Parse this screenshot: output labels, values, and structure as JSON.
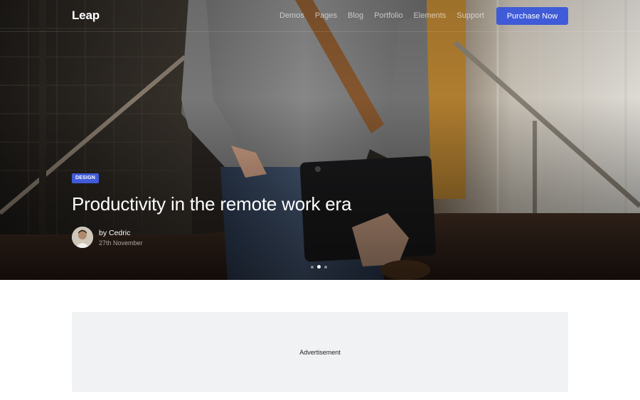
{
  "brand": {
    "name": "Leap"
  },
  "nav": {
    "links": [
      {
        "label": "Demos"
      },
      {
        "label": "Pages"
      },
      {
        "label": "Blog"
      },
      {
        "label": "Portfolio"
      },
      {
        "label": "Elements"
      },
      {
        "label": "Support"
      }
    ],
    "cta_label": "Purchase Now"
  },
  "hero": {
    "category": "DESIGN",
    "title": "Productivity in the remote work era",
    "author": "by Cedric",
    "date": "27th November",
    "slides": {
      "count": 3,
      "active_index": 1
    }
  },
  "advertisement": {
    "label": "Advertisement"
  },
  "colors": {
    "accent": "#3f5bd8",
    "ad_background": "#f1f2f4",
    "page_background": "#ffffff"
  }
}
